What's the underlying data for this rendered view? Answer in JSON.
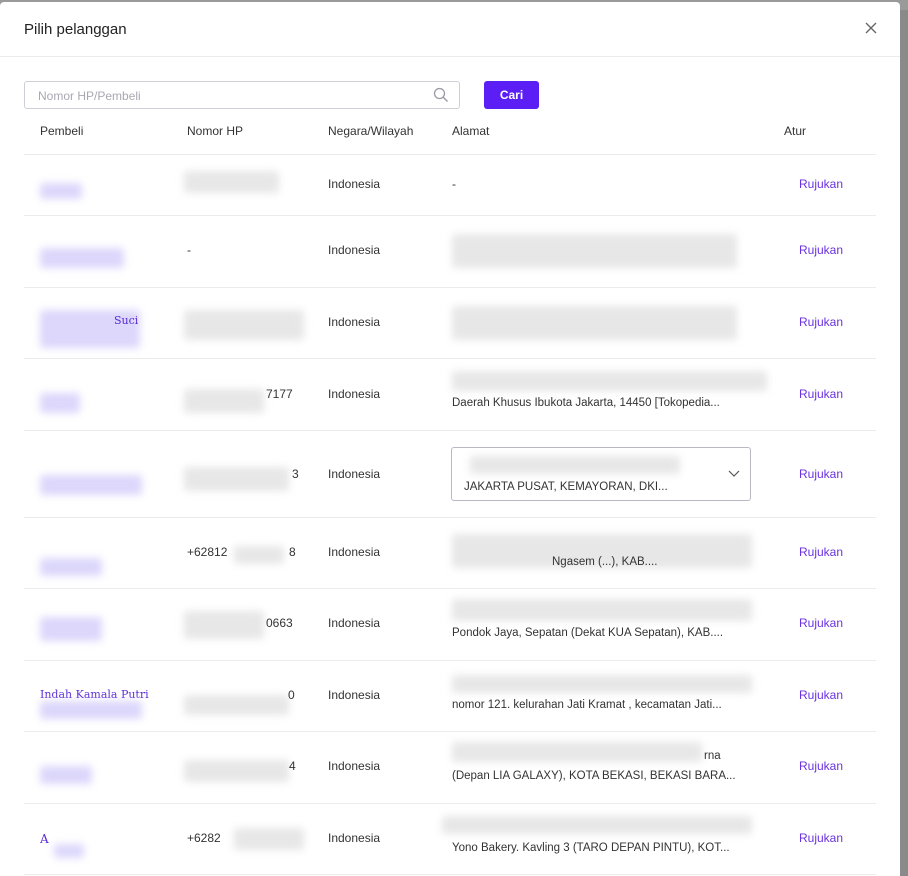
{
  "modal": {
    "title": "Pilih pelanggan"
  },
  "search": {
    "placeholder": "Nomor HP/Pembeli",
    "button_label": "Cari"
  },
  "table": {
    "headers": {
      "buyer": "Pembeli",
      "phone": "Nomor HP",
      "country": "Negara/Wilayah",
      "address": "Alamat",
      "action": "Atur"
    },
    "rows": [
      {
        "name": "",
        "phone": "",
        "country": "Indonesia",
        "address": "-",
        "action": "Rujukan"
      },
      {
        "name": "",
        "phone": "-",
        "country": "Indonesia",
        "address": "",
        "action": "Rujukan"
      },
      {
        "name": "Suci",
        "phone": "",
        "country": "Indonesia",
        "address": "",
        "action": "Rujukan"
      },
      {
        "name": "",
        "phone": "7177",
        "country": "Indonesia",
        "address": "Daerah Khusus Ibukota Jakarta, 14450 [Tokopedia...",
        "action": "Rujukan"
      },
      {
        "name": "",
        "phone": "3",
        "country": "Indonesia",
        "address": "JAKARTA PUSAT, KEMAYORAN, DKI...",
        "action": "Rujukan"
      },
      {
        "name": "",
        "phone": "+62812",
        "phone_suffix": "8",
        "country": "Indonesia",
        "address": "Ngasem (...), KAB....",
        "action": "Rujukan"
      },
      {
        "name": "",
        "phone": "0663",
        "country": "Indonesia",
        "address": "Pondok Jaya, Sepatan (Dekat KUA Sepatan), KAB....",
        "action": "Rujukan"
      },
      {
        "name": "Indah Kamala Putri",
        "phone": "0",
        "country": "Indonesia",
        "address": "nomor 121. kelurahan Jati Kramat , kecamatan Jati...",
        "action": "Rujukan"
      },
      {
        "name": "",
        "phone": "4",
        "country": "Indonesia",
        "address": "(Depan LIA GALAXY), KOTA BEKASI, BEKASI BARA...",
        "address_top": "rna",
        "action": "Rujukan"
      },
      {
        "name": "A",
        "phone": "+6282",
        "country": "Indonesia",
        "address": "Yono Bakery. Kavling 3 (TARO DEPAN PINTU), KOT...",
        "action": "Rujukan"
      }
    ]
  },
  "colors": {
    "primary": "#5b1ef5",
    "link": "#6b32e0",
    "border": "#ececec"
  },
  "icons": {
    "close": "close-icon",
    "search": "search-icon",
    "chevron": "chevron-down-icon"
  }
}
